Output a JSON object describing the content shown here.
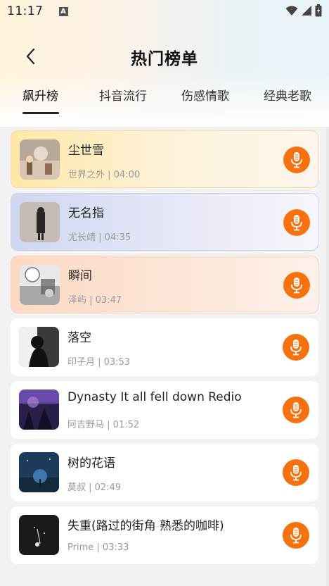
{
  "status": {
    "time": "11:17",
    "notif_letter": "A"
  },
  "header": {
    "title": "热门榜单"
  },
  "tabs": [
    {
      "label": "飙升榜",
      "active": true
    },
    {
      "label": "抖音流行",
      "active": false
    },
    {
      "label": "伤感情歌",
      "active": false
    },
    {
      "label": "经典老歌",
      "active": false
    }
  ],
  "songs": [
    {
      "title": "尘世雪",
      "meta": "世界之外 | 04:00"
    },
    {
      "title": "无名指",
      "meta": "尤长靖 | 04:35"
    },
    {
      "title": "瞬间",
      "meta": "泽屿 | 03:47"
    },
    {
      "title": "落空",
      "meta": "印子月 | 03:53"
    },
    {
      "title": "Dynasty It all fell down Redio",
      "meta": "阿吉野马 | 01:52"
    },
    {
      "title": "树的花语",
      "meta": "莫叔 | 02:49"
    },
    {
      "title": "失重(路过的街角 熟悉的咖啡)",
      "meta": "Prime | 03:33"
    }
  ],
  "colors": {
    "accent": "#f7720f"
  },
  "icons": {
    "back": "back-arrow-icon",
    "mic": "microphone-icon"
  }
}
